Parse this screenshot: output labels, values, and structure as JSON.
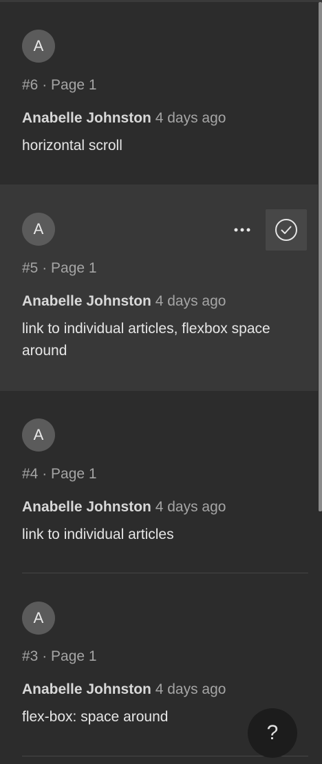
{
  "comments": [
    {
      "avatar_letter": "A",
      "meta": "#6 · Page 1",
      "author": "Anabelle Johnston",
      "time": "4 days ago",
      "text": "horizontal scroll"
    },
    {
      "avatar_letter": "A",
      "meta": "#5 · Page 1",
      "author": "Anabelle Johnston",
      "time": "4 days ago",
      "text": "link to individual articles, flexbox space around"
    },
    {
      "avatar_letter": "A",
      "meta": "#4 · Page 1",
      "author": "Anabelle Johnston",
      "time": "4 days ago",
      "text": "link to individual articles"
    },
    {
      "avatar_letter": "A",
      "meta": "#3 · Page 1",
      "author": "Anabelle Johnston",
      "time": "4 days ago",
      "text": "flex-box: space around"
    }
  ],
  "help": {
    "label": "?"
  },
  "colors": {
    "background": "#2c2c2c",
    "hover_background": "#383838",
    "avatar": "#5b5b5b"
  }
}
